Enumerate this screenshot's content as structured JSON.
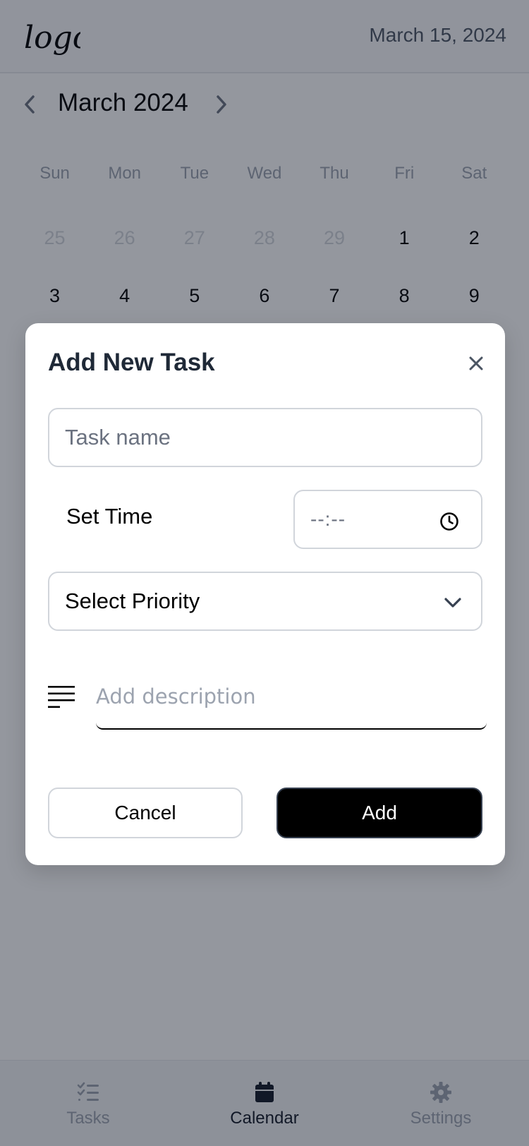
{
  "header": {
    "logo_text": "logo",
    "date": "March 15, 2024"
  },
  "calendar": {
    "month_title": "March 2024",
    "weekdays": [
      "Sun",
      "Mon",
      "Tue",
      "Wed",
      "Thu",
      "Fri",
      "Sat"
    ],
    "weeks": [
      [
        "25",
        "26",
        "27",
        "28",
        "29",
        "1",
        "2"
      ],
      [
        "3",
        "4",
        "5",
        "6",
        "7",
        "8",
        "9"
      ]
    ],
    "muted_days_first_row": 5
  },
  "modal": {
    "title": "Add New Task",
    "task_name_placeholder": "Task name",
    "set_time_label": "Set Time",
    "time_placeholder": "--:--",
    "priority_label": "Select Priority",
    "description_placeholder": "Add description",
    "cancel_label": "Cancel",
    "add_label": "Add"
  },
  "bottom_nav": {
    "items": [
      {
        "label": "Tasks",
        "icon": "checklist-icon",
        "active": false
      },
      {
        "label": "Calendar",
        "icon": "calendar-icon",
        "active": true
      },
      {
        "label": "Settings",
        "icon": "gear-icon",
        "active": false
      }
    ]
  },
  "colors": {
    "overlay": "#111827",
    "primary": "#000000",
    "muted": "#9ca3af"
  }
}
